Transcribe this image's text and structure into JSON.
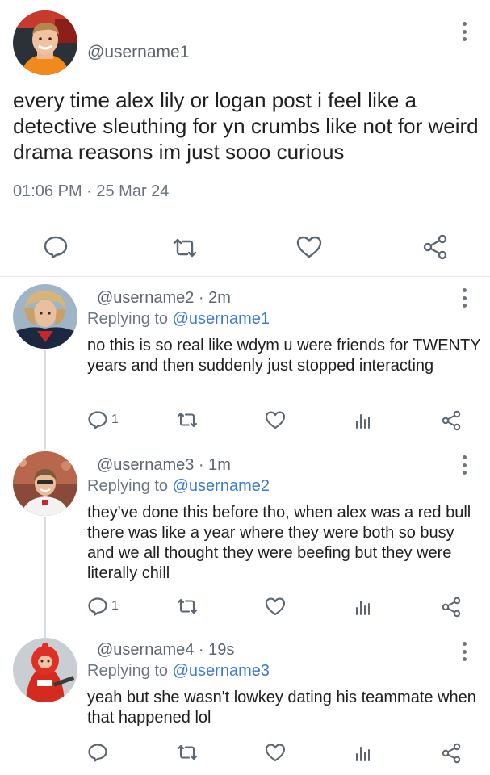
{
  "main_tweet": {
    "username": "@username1",
    "text": "every time alex lily or logan post i feel like a detective sleuthing for yn crumbs like not for weird drama reasons im just sooo curious",
    "time": "01:06 PM · 25 Mar 24",
    "avatar_icon": "profile-photo-icon",
    "actions": [
      "reply-icon",
      "retweet-icon",
      "like-icon",
      "share-icon"
    ]
  },
  "replies": [
    {
      "username_line": "@username2 · 2m",
      "replying_prefix": "Replying to ",
      "replying_handle": "@username1",
      "text": "no this is so real like wdym u were friends for TWENTY years and then suddenly just stopped interacting",
      "reply_count": "1"
    },
    {
      "username_line": "@username3 · 1m",
      "replying_prefix": "Replying to ",
      "replying_handle": "@username2",
      "text": "they've done this before tho, when alex was a red bull there was like a year where they were both so busy and we all thought they were beefing but they were literally chill",
      "reply_count": "1"
    },
    {
      "username_line": "@username4 · 19s",
      "replying_prefix": "Replying to ",
      "replying_handle": "@username3",
      "text": "yeah but she wasn't lowkey dating his teammate when that happened lol",
      "reply_count": ""
    }
  ],
  "colors": {
    "link": "#3a7bd5",
    "icon": "#5b6670",
    "divider": "#e6e9eb"
  }
}
